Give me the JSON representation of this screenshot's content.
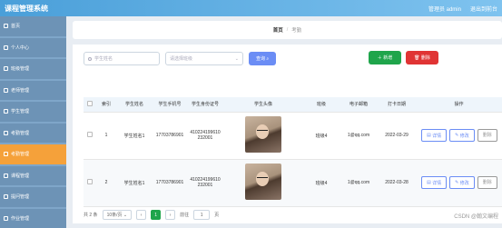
{
  "app": {
    "title": "课程管理系统",
    "user_label": "管理员 admin",
    "exit_label": "退出到前台"
  },
  "sidebar": {
    "items": [
      {
        "label": "首页",
        "icon": "home-icon"
      },
      {
        "label": "个人中心",
        "icon": "user-icon"
      },
      {
        "label": "班级管理",
        "icon": "grid-icon"
      },
      {
        "label": "老师管理",
        "icon": "grid-icon"
      },
      {
        "label": "学生管理",
        "icon": "grid-icon"
      },
      {
        "label": "考勤管理",
        "icon": "grid-icon"
      },
      {
        "label": "考勤管理",
        "icon": "grid-icon",
        "active": true
      },
      {
        "label": "课程管理",
        "icon": "grid-icon"
      },
      {
        "label": "提问管理",
        "icon": "grid-icon"
      },
      {
        "label": "作业管理",
        "icon": "grid-icon"
      }
    ]
  },
  "breadcrumb": {
    "home": "首页",
    "sep": "/",
    "current": "考勤"
  },
  "search": {
    "name_placeholder": "学生姓名",
    "class_placeholder": "请选择班级",
    "search_label": "查询"
  },
  "actions": {
    "add_label": "新增",
    "delete_label": "删除"
  },
  "table": {
    "headers": [
      "",
      "索引",
      "学生姓名",
      "学生手机号",
      "学生身份证号",
      "学生头像",
      "班级",
      "电子邮箱",
      "打卡日期",
      "操作"
    ],
    "rows": [
      {
        "index": "1",
        "name": "学生姓名1",
        "phone": "17703786901",
        "idcard": "410224199610232001",
        "class": "班级4",
        "email": "1@qq.com",
        "date": "2022-03-29"
      },
      {
        "index": "2",
        "name": "学生姓名1",
        "phone": "17703786901",
        "idcard": "410224199610232001",
        "class": "班级4",
        "email": "1@qq.com",
        "date": "2022-03-28"
      }
    ],
    "op_labels": {
      "detail": "详情",
      "edit": "修改",
      "delete": "删除"
    }
  },
  "pager": {
    "total": "共 2 条",
    "page_size": "10条/页",
    "current_page": "1",
    "goto_label": "前往",
    "goto_value": "1",
    "page_suffix": "页"
  },
  "watermark": "CSDN @翰文编程"
}
